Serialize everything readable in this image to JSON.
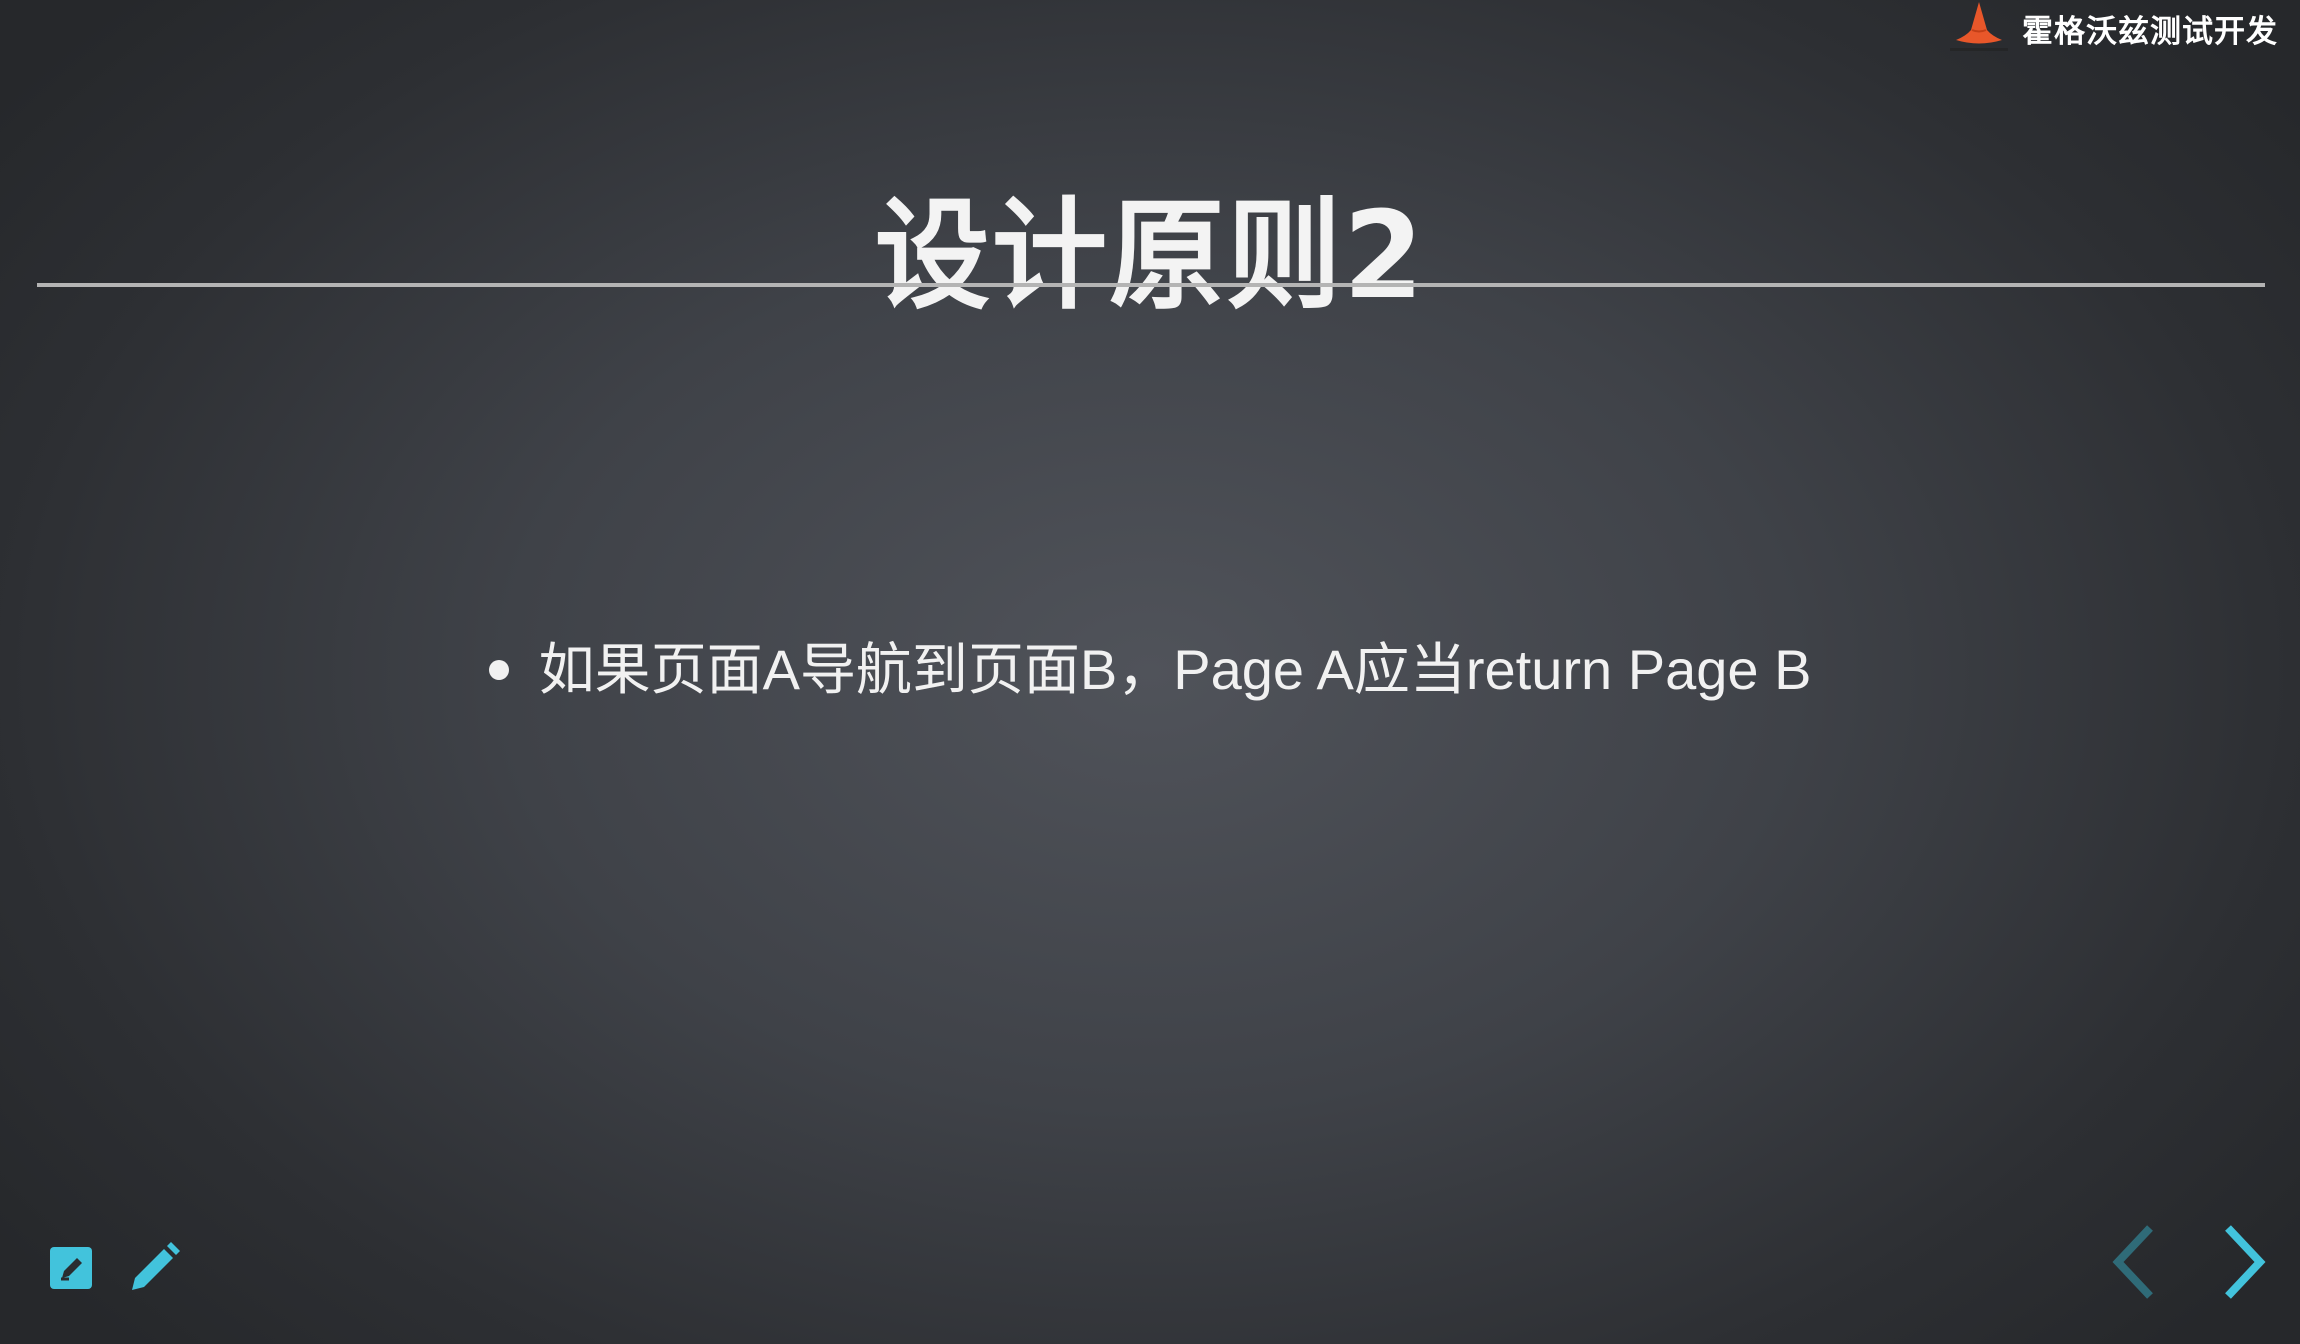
{
  "brand": {
    "text": "霍格沃兹测试开发",
    "logo_icon": "wizard-hat-icon"
  },
  "slide": {
    "title": "设计原则2",
    "bullets": [
      "如果页面A导航到页面B，Page A应当return Page B"
    ]
  },
  "toolbar": {
    "edit_icon": "edit-note-icon",
    "pencil_icon": "pencil-icon"
  },
  "navigation": {
    "prev_icon": "chevron-left-icon",
    "next_icon": "chevron-right-icon"
  },
  "colors": {
    "accent": "#42c3dc",
    "accent_dim": "#2f6b78",
    "title": "#f3f3f3",
    "rule": "#b4b4b4",
    "logo": "#e8572a"
  }
}
